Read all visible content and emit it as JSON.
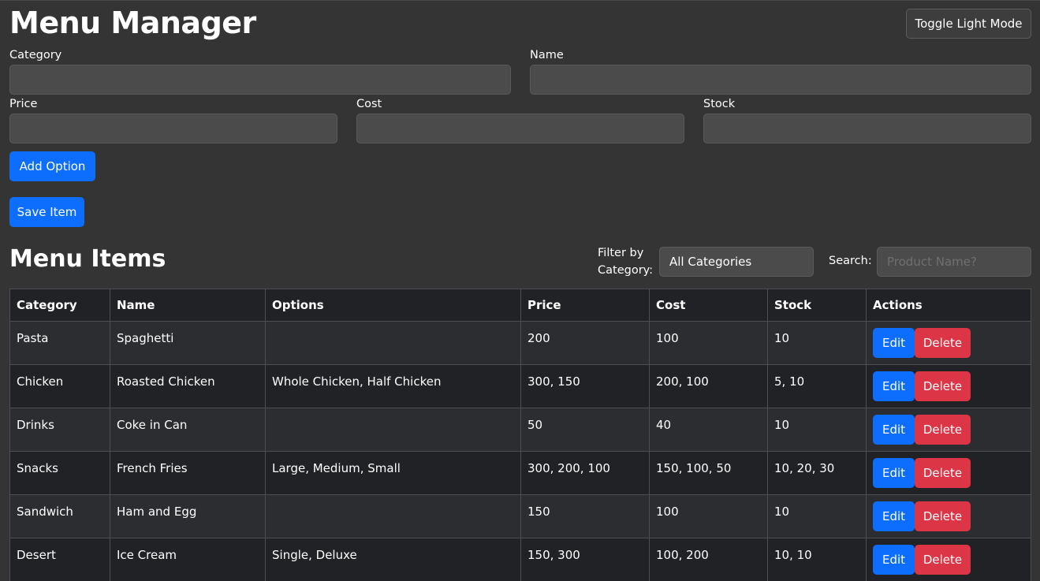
{
  "header": {
    "title": "Menu Manager",
    "toggle_label": "Toggle Light Mode"
  },
  "form": {
    "category_label": "Category",
    "category_value": "",
    "name_label": "Name",
    "name_value": "",
    "price_label": "Price",
    "price_value": "",
    "cost_label": "Cost",
    "cost_value": "",
    "stock_label": "Stock",
    "stock_value": "",
    "add_option_label": "Add Option",
    "save_item_label": "Save Item"
  },
  "list": {
    "title": "Menu Items",
    "filter_label": "Filter by Category:",
    "filter_selected": "All Categories",
    "search_label": "Search:",
    "search_placeholder": "Product Name?"
  },
  "table": {
    "headers": [
      "Category",
      "Name",
      "Options",
      "Price",
      "Cost",
      "Stock",
      "Actions"
    ],
    "edit_label": "Edit",
    "delete_label": "Delete",
    "rows": [
      {
        "category": "Pasta",
        "name": "Spaghetti",
        "options": "",
        "price": "200",
        "cost": "100",
        "stock": "10"
      },
      {
        "category": "Chicken",
        "name": "Roasted Chicken",
        "options": "Whole Chicken, Half Chicken",
        "price": "300, 150",
        "cost": "200, 100",
        "stock": "5, 10"
      },
      {
        "category": "Drinks",
        "name": "Coke in Can",
        "options": "",
        "price": "50",
        "cost": "40",
        "stock": "10"
      },
      {
        "category": "Snacks",
        "name": "French Fries",
        "options": "Large, Medium, Small",
        "price": "300, 200, 100",
        "cost": "150, 100, 50",
        "stock": "10, 20, 30"
      },
      {
        "category": "Sandwich",
        "name": "Ham and Egg",
        "options": "",
        "price": "150",
        "cost": "100",
        "stock": "10"
      },
      {
        "category": "Desert",
        "name": "Ice Cream",
        "options": "Single, Deluxe",
        "price": "150, 300",
        "cost": "100, 200",
        "stock": "10, 10"
      }
    ]
  },
  "colors": {
    "background": "#343434",
    "primary": "#0d6efd",
    "danger": "#dc3545"
  }
}
